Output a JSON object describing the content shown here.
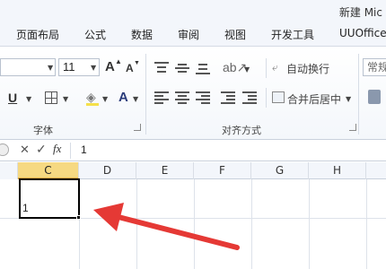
{
  "window": {
    "title": "新建 Mic"
  },
  "menu": {
    "tabs": [
      "页面布局",
      "公式",
      "数据",
      "审阅",
      "视图",
      "开发工具",
      "UUOffice"
    ]
  },
  "ribbon": {
    "font_group": {
      "font_size": "11",
      "grow_font": "A",
      "shrink_font": "A",
      "underline": "U",
      "font_color": "A",
      "label": "字体"
    },
    "alignment_group": {
      "wrap_text": "自动换行",
      "merge_center": "合并后居中",
      "label": "对齐方式"
    },
    "number_group": {
      "format": "常规"
    }
  },
  "formula_bar": {
    "value": "1"
  },
  "grid": {
    "columns": [
      "C",
      "D",
      "E",
      "F",
      "G",
      "H"
    ],
    "active_column": "C",
    "active_cell_value": "1"
  },
  "annotation": {
    "arrow_color": "#e53935"
  }
}
